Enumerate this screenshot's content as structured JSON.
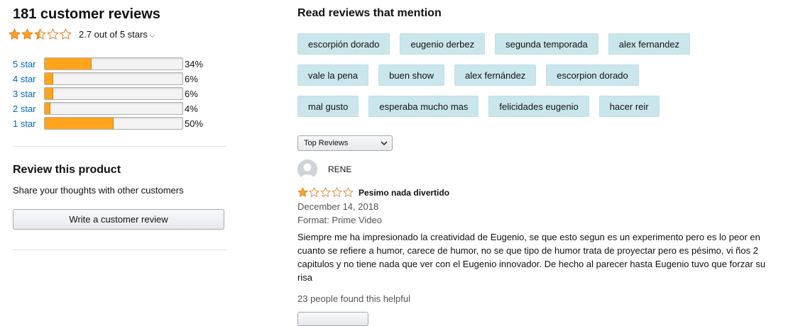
{
  "summary": {
    "title": "181 customer reviews",
    "average_text": "2.7 out of 5 stars",
    "rating": 2.7,
    "histogram": [
      {
        "label": "5 star",
        "percent_text": "34%",
        "fraction": 0.34
      },
      {
        "label": "4 star",
        "percent_text": "6%",
        "fraction": 0.06
      },
      {
        "label": "3 star",
        "percent_text": "6%",
        "fraction": 0.06
      },
      {
        "label": "2 star",
        "percent_text": "4%",
        "fraction": 0.04
      },
      {
        "label": "1 star",
        "percent_text": "50%",
        "fraction": 0.5
      }
    ]
  },
  "review_product": {
    "title": "Review this product",
    "subtitle": "Share your thoughts with other customers",
    "button_label": "Write a customer review"
  },
  "mentions": {
    "title": "Read reviews that mention",
    "rows": [
      [
        "escorpión dorado",
        "eugenio derbez",
        "segunda temporada",
        "alex fernandez"
      ],
      [
        "vale la pena",
        "buen show",
        "alex fernández",
        "escorpion dorado"
      ],
      [
        "mal gusto",
        "esperaba mucho mas",
        "felicidades eugenio",
        "hacer reir"
      ]
    ]
  },
  "sort": {
    "selected": "Top Reviews"
  },
  "review": {
    "author": "RENE",
    "rating": 1,
    "title": "Pesimo nada divertido",
    "date": "December 14, 2018",
    "format": "Format: Prime Video",
    "body": "Siempre me ha impresionado la creatividad de Eugenio, se que esto segun es un experimento pero es lo peor en cuanto se refiere a humor, carece de humor, no se que tipo de humor trata de proyectar pero es pésimo, vi ños 2 capitulos y no tiene nada que ver con el Eugenio innovador. De hecho al parecer hasta Eugenio tuvo que forzar su risa",
    "helpful_text": "23 people found this helpful"
  },
  "colors": {
    "star": "#ffa41c",
    "chip": "#cae6ed",
    "link": "#0066c0",
    "bar_fill": "#ffa41c"
  },
  "icons": {
    "rating_stars": "star-icon",
    "sort_caret": "chevron-down-icon",
    "avatar": "user-avatar-icon"
  }
}
